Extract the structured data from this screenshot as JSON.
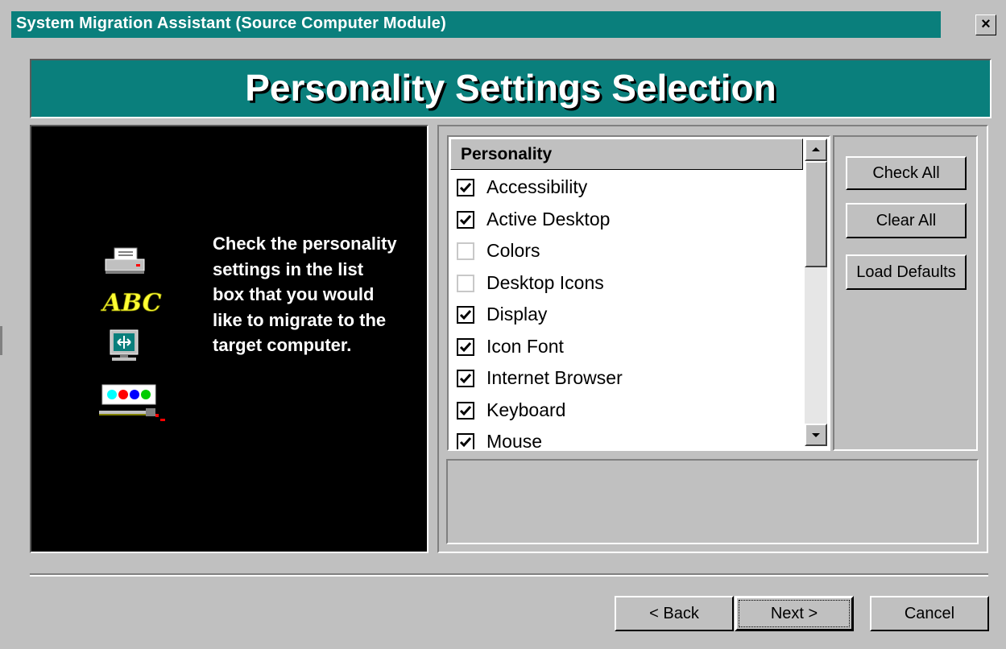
{
  "window": {
    "title": "System Migration Assistant (Source Computer Module)",
    "close_glyph": "×"
  },
  "banner": {
    "title": "Personality Settings Selection"
  },
  "instructions": {
    "text": "Check the personality settings in the list box that you would like to migrate to the target computer."
  },
  "illustration_icons": [
    "printer-icon",
    "fonts-abc-icon",
    "display-monitor-icon",
    "color-palette-icon"
  ],
  "list": {
    "header": "Personality",
    "items": [
      {
        "label": "Accessibility",
        "checked": true
      },
      {
        "label": "Active Desktop",
        "checked": true
      },
      {
        "label": "Colors",
        "checked": false
      },
      {
        "label": "Desktop Icons",
        "checked": false
      },
      {
        "label": "Display",
        "checked": true
      },
      {
        "label": "Icon Font",
        "checked": true
      },
      {
        "label": "Internet Browser",
        "checked": true
      },
      {
        "label": "Keyboard",
        "checked": true
      },
      {
        "label": "Mouse",
        "checked": true
      }
    ]
  },
  "side_buttons": {
    "check_all": "Check All",
    "clear_all": "Clear All",
    "load_defaults": "Load Defaults"
  },
  "footer": {
    "back": "< Back",
    "next": "Next >",
    "cancel": "Cancel"
  },
  "colors": {
    "teal": "#0a7f7c",
    "face": "#c0c0c0",
    "instruction_text": "#ffffff",
    "abc_yellow": "#ffff33"
  }
}
